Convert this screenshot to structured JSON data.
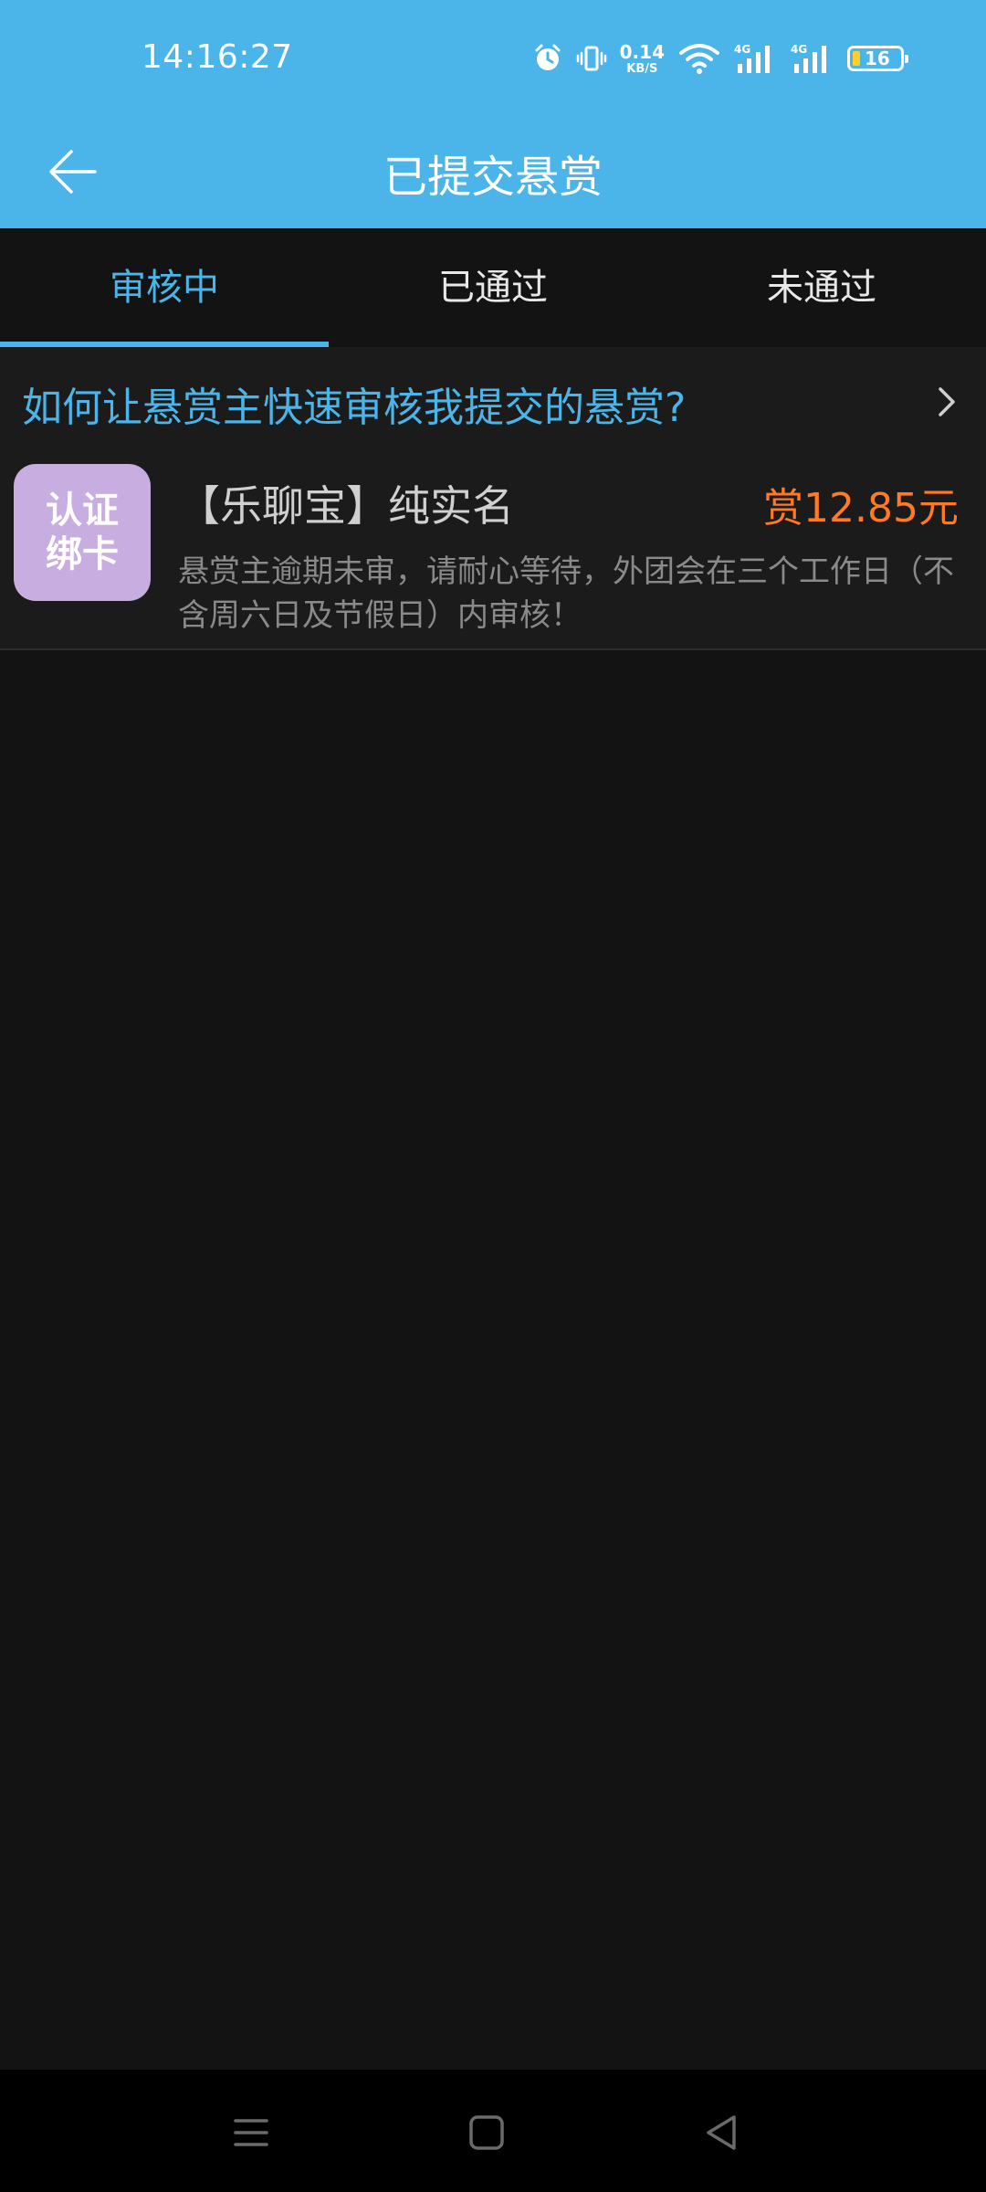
{
  "status_bar": {
    "time": "14:16:27",
    "net_speed_value": "0.14",
    "net_speed_unit": "KB/S",
    "battery_level": "16",
    "icons": [
      "alarm-icon",
      "vibrate-icon",
      "wifi-icon",
      "signal-4g-icon",
      "signal-4g-icon",
      "battery-icon"
    ]
  },
  "header": {
    "title": "已提交悬赏",
    "back_icon": "arrow-left-icon"
  },
  "tabs": [
    {
      "label": "审核中",
      "active": true
    },
    {
      "label": "已通过",
      "active": false
    },
    {
      "label": "未通过",
      "active": false
    }
  ],
  "help": {
    "text": "如何让悬赏主快速审核我提交的悬赏?",
    "chevron_icon": "chevron-right-icon"
  },
  "tasks": [
    {
      "icon_line1": "认证",
      "icon_line2": "绑卡",
      "title": "【乐聊宝】纯实名",
      "reward": "赏12.85元",
      "note": "悬赏主逾期未审，请耐心等待，外团会在三个工作日（不含周六日及节假日）内审核！"
    }
  ],
  "nav_bar": {
    "icons": [
      "menu-icon",
      "home-icon",
      "back-icon"
    ]
  },
  "colors": {
    "accent": "#4bb4e8",
    "reward": "#ff7a26",
    "background": "#131313",
    "card_icon_bg": "#c8aee0"
  }
}
